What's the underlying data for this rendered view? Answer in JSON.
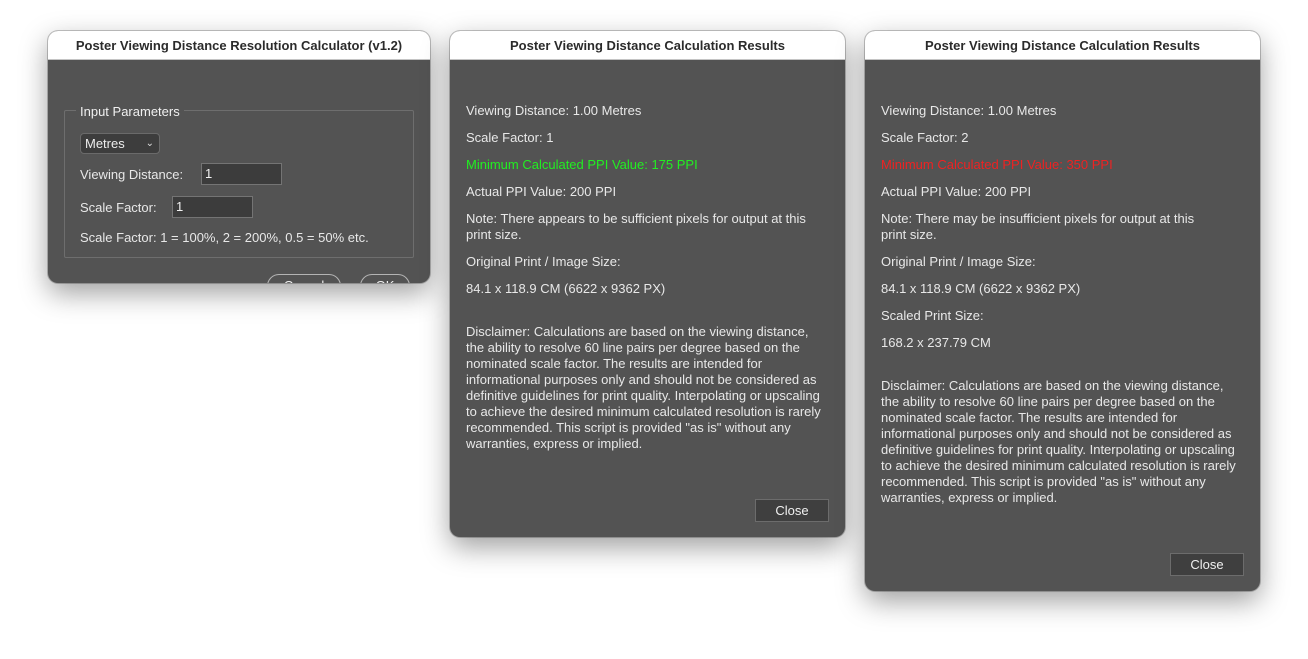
{
  "input_dialog": {
    "title": "Poster Viewing Distance Resolution Calculator (v1.2)",
    "group_label": "Input Parameters",
    "unit_select": "Metres",
    "viewing_distance_label": "Viewing Distance:",
    "viewing_distance_value": "1",
    "scale_factor_label": "Scale Factor:",
    "scale_factor_value": "1",
    "scale_hint": "Scale Factor: 1 = 100%, 2 = 200%, 0.5 = 50% etc.",
    "cancel_label": "Cancel",
    "ok_label": "OK"
  },
  "result1": {
    "title": "Poster Viewing Distance Calculation Results",
    "viewing_distance": "Viewing Distance: 1.00 Metres",
    "scale_factor": "Scale Factor: 1",
    "min_ppi": "Minimum Calculated PPI Value: 175 PPI",
    "actual_ppi": "Actual PPI Value: 200 PPI",
    "note": "Note: There appears to be sufficient pixels for output at this print size.",
    "original_size_label": "Original Print / Image Size:",
    "original_size_value": "84.1 x 118.9 CM (6622 x 9362 PX)",
    "disclaimer": "Disclaimer: Calculations are based on the viewing distance, the ability to resolve 60 line pairs per degree based on the nominated scale factor. The results are intended for informational purposes only and should not be considered as definitive guidelines for print quality. Interpolating or upscaling to achieve the desired minimum calculated resolution is rarely recommended. This script is provided \"as is\" without any warranties, express or implied.",
    "close_label": "Close"
  },
  "result2": {
    "title": "Poster Viewing Distance Calculation Results",
    "viewing_distance": "Viewing Distance: 1.00 Metres",
    "scale_factor": "Scale Factor: 2",
    "min_ppi": "Minimum Calculated PPI Value: 350 PPI",
    "actual_ppi": "Actual PPI Value: 200 PPI",
    "note": "Note: There may be insufficient pixels for output at this print size.",
    "original_size_label": "Original Print / Image Size:",
    "original_size_value": "84.1 x 118.9 CM (6622 x 9362 PX)",
    "scaled_size_label": "Scaled Print Size:",
    "scaled_size_value": "168.2 x 237.79 CM",
    "disclaimer": "Disclaimer: Calculations are based on the viewing distance, the ability to resolve 60 line pairs per degree based on the nominated scale factor. The results are intended for informational purposes only and should not be considered as definitive guidelines for print quality. Interpolating or upscaling to achieve the desired minimum calculated resolution is rarely recommended. This script is provided \"as is\" without any warranties, express or implied.",
    "close_label": "Close"
  },
  "colors": {
    "sufficient": "#22ee22",
    "insufficient": "#ee2222"
  }
}
